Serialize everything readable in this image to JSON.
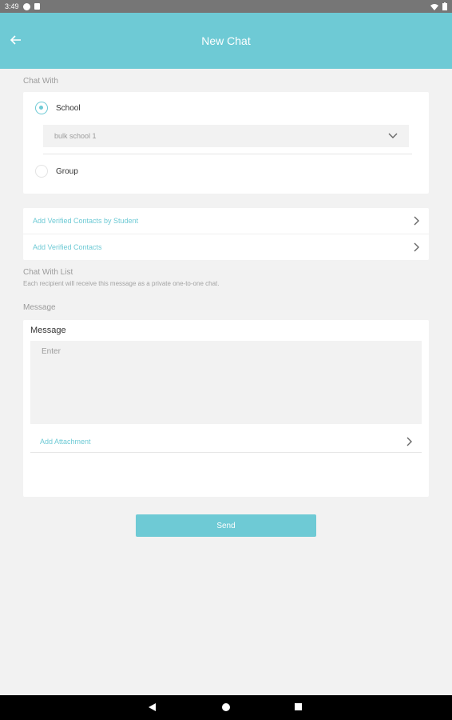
{
  "status_bar": {
    "time": "3:49"
  },
  "app_bar": {
    "title": "New Chat",
    "back_icon": "arrow-left-icon"
  },
  "chat_with": {
    "label": "Chat With",
    "options": [
      {
        "label": "School",
        "selected": true
      },
      {
        "label": "Group",
        "selected": false
      }
    ],
    "school_select": {
      "value": "bulk school 1",
      "icon": "chevron-down-icon"
    }
  },
  "contacts": {
    "items": [
      {
        "label": "Add Verified Contacts by Student",
        "icon": "chevron-right-icon"
      },
      {
        "label": "Add Verified Contacts",
        "icon": "chevron-right-icon"
      }
    ]
  },
  "chat_with_list": {
    "label": "Chat With List",
    "helper": "Each recipient will receive this message as a private one-to-one chat."
  },
  "message": {
    "section_label": "Message",
    "card_title": "Message",
    "placeholder": "Enter",
    "attachment_label": "Add Attachment"
  },
  "send_button": {
    "label": "Send"
  },
  "colors": {
    "accent": "#6ecad5",
    "background": "#f2f2f2",
    "status_bar": "#767676",
    "nav_bar": "#000000"
  }
}
